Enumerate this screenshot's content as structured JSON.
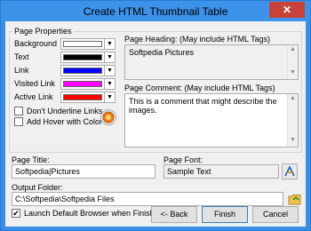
{
  "window": {
    "title": "Create HTML Thumbnail Table",
    "close_glyph": "✕"
  },
  "page_properties": {
    "group_label": "Page Properties",
    "colors": [
      {
        "label": "Background",
        "swatch": "#ffffff"
      },
      {
        "label": "Text",
        "swatch": "#000000"
      },
      {
        "label": "Link",
        "swatch": "#0000ff"
      },
      {
        "label": "Visited Link",
        "swatch": "#ff00ff"
      },
      {
        "label": "Active Link",
        "swatch": "#ff0000"
      }
    ],
    "dont_underline_label": "Don't Underline Links",
    "add_hover_label": "Add Hover with Color",
    "hover_icon": "circle-color-icon",
    "heading_label": "Page Heading: (May include HTML Tags)",
    "heading_value": "Softpedia Pictures",
    "comment_label": "Page Comment: (May include HTML Tags)",
    "comment_value": "This is a comment that might describe the images."
  },
  "page_title": {
    "label": "Page Title:",
    "value": "Softpedia|Pictures"
  },
  "page_font": {
    "label": "Page Font:",
    "value": "Sample Text",
    "icon": "font-icon"
  },
  "output_folder": {
    "label": "Output Folder:",
    "value": "C:\\Softpedia\\Softpedia Files",
    "icon": "folder-icon"
  },
  "launch_browser": {
    "label": "Launch Default Browser when Finished",
    "checked": true,
    "mark": "✔"
  },
  "buttons": {
    "back": "<- Back",
    "finish": "Finish",
    "cancel": "Cancel"
  }
}
